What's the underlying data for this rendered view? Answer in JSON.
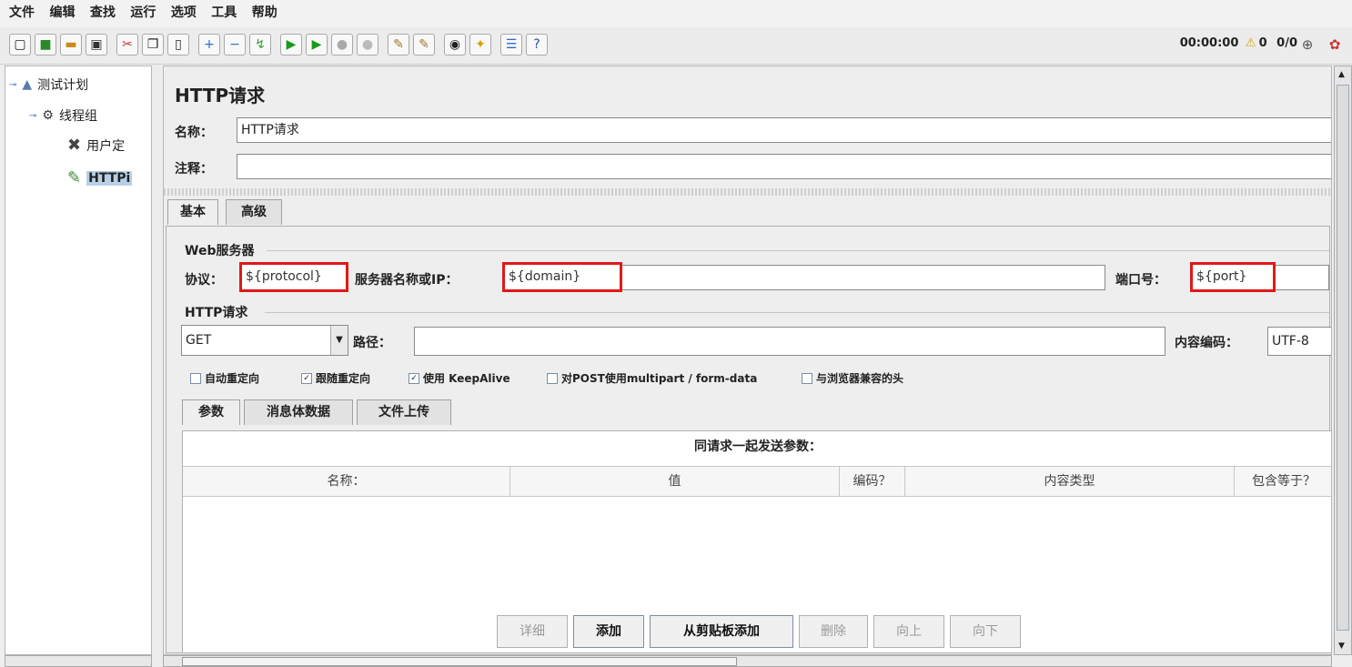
{
  "menu": [
    "文件",
    "编辑",
    "查找",
    "运行",
    "选项",
    "工具",
    "帮助"
  ],
  "toolbar_icons": [
    "new-icon",
    "templates-icon",
    "open-icon",
    "save-icon",
    "cut-icon",
    "copy-icon",
    "paste-icon",
    "expand-icon",
    "collapse-icon",
    "toggle-icon",
    "start-icon",
    "start-no-pause-icon",
    "stop-icon",
    "shutdown-icon",
    "clear-icon",
    "clear-all-icon",
    "search-icon",
    "reset-search-icon",
    "function-helper-icon",
    "help-icon"
  ],
  "status": {
    "timer": "00:00:00",
    "warnings": "0",
    "threads": "0/0"
  },
  "tree": {
    "plan": "测试计划",
    "thread_group": "线程组",
    "user_defined": "用户定",
    "http": "HTTPi"
  },
  "form": {
    "title": "HTTP请求",
    "name_label": "名称：",
    "name_value": "HTTP请求",
    "comment_label": "注释：",
    "comment_value": ""
  },
  "tabs": {
    "basic": "基本",
    "advanced": "高级"
  },
  "web_server": {
    "group_title": "Web服务器",
    "protocol_label": "协议：",
    "protocol_value": "${protocol}",
    "server_label": "服务器名称或IP：",
    "server_value": "${domain}",
    "port_label": "端口号：",
    "port_value": "${port}"
  },
  "http_request": {
    "group_title": "HTTP请求",
    "method": "GET",
    "path_label": "路径：",
    "path_value": "",
    "encoding_label": "内容编码：",
    "encoding_value": "UTF-8"
  },
  "checkboxes": [
    {
      "label": "自动重定向",
      "checked": false
    },
    {
      "label": "跟随重定向",
      "checked": true
    },
    {
      "label": "使用 KeepAlive",
      "checked": true
    },
    {
      "label": "对POST使用multipart / form-data",
      "checked": false
    },
    {
      "label": "与浏览器兼容的头",
      "checked": false
    }
  ],
  "sub_tabs": [
    "参数",
    "消息体数据",
    "文件上传"
  ],
  "params_table": {
    "caption": "同请求一起发送参数：",
    "columns": [
      "名称：",
      "值",
      "编码？",
      "内容类型",
      "包含等于？"
    ]
  },
  "buttons": {
    "detail": "详细",
    "add": "添加",
    "add_clipboard": "从剪贴板添加",
    "delete": "删除",
    "up": "向上",
    "down": "向下"
  }
}
